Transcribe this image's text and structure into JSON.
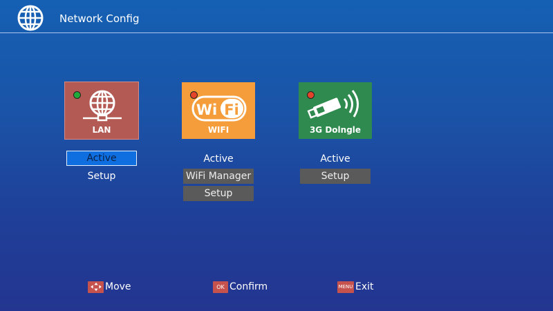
{
  "header": {
    "title": "Network Config",
    "icon": "globe-icon"
  },
  "tiles": [
    {
      "label": "LAN",
      "icon": "lan-globe-icon",
      "color": "#b35a54",
      "led": "#1faa3a",
      "options": [
        "Active",
        "Setup"
      ]
    },
    {
      "label": "WIFI",
      "icon": "wifi-logo-icon",
      "color": "#f59d3b",
      "led": "#e4452a",
      "logo_text": "Wi Fi",
      "options": [
        "Active",
        "WiFi Manager",
        "Setup"
      ]
    },
    {
      "label": "3G Dolngle",
      "icon": "usb-dongle-icon",
      "color": "#2e8a4e",
      "led": "#e4452a",
      "options": [
        "Active",
        "Setup"
      ]
    }
  ],
  "footer": [
    {
      "key": "",
      "key_icon": "arrows-icon",
      "label": "Move"
    },
    {
      "key": "OK",
      "label": "Confirm"
    },
    {
      "key": "MENU",
      "label": "Exit"
    }
  ],
  "colors": {
    "selected": "#0f6fe0",
    "disabled": "#5a5a5a",
    "key": "#c6524e"
  }
}
